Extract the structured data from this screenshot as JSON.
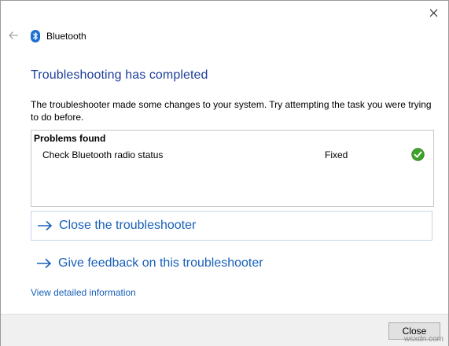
{
  "window": {
    "title": "Bluetooth",
    "close_glyph": "✕"
  },
  "heading": "Troubleshooting has completed",
  "description": "The troubleshooter made some changes to your system. Try attempting the task you were trying to do before.",
  "problems": {
    "header": "Problems found",
    "rows": [
      {
        "name": "Check Bluetooth radio status",
        "status": "Fixed",
        "icon": "check-circle-icon"
      }
    ]
  },
  "actions": {
    "close_troubleshooter": "Close the troubleshooter",
    "give_feedback": "Give feedback on this troubleshooter"
  },
  "detail_link": "View detailed information",
  "footer": {
    "close_button": "Close"
  },
  "watermark": "wsxdn.com",
  "colors": {
    "heading": "#1e3f9a",
    "link": "#1760b8",
    "check": "#3ea32a"
  }
}
